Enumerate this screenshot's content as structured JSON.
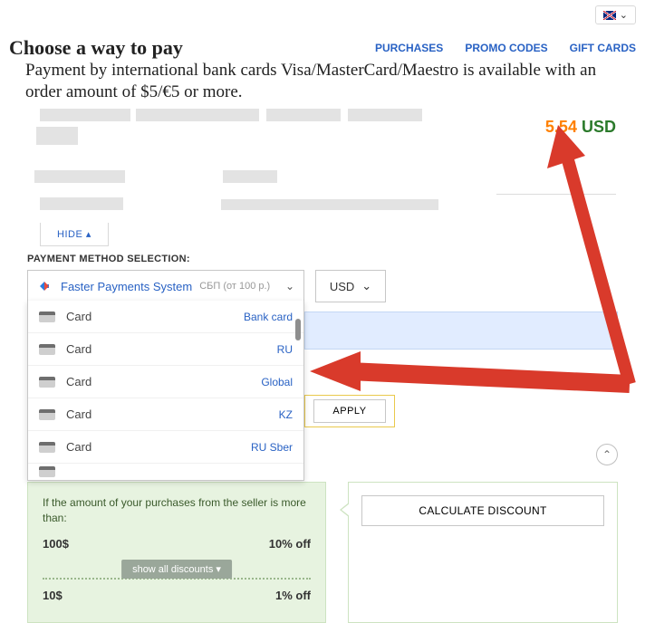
{
  "locale": {
    "chevron": "⌄"
  },
  "header": {
    "title": "Choose a way to pay",
    "nav": {
      "purchases": "PURCHASES",
      "promo": "PROMO CODES",
      "gift": "GIFT CARDS"
    }
  },
  "info_text": "Payment by international bank cards Visa/MasterCard/Maestro is available with an order amount of $5/€5 or more.",
  "price": {
    "amount": "5.54",
    "currency": "USD"
  },
  "hide_btn": "HIDE ▴",
  "pms_label": "PAYMENT METHOD SELECTION:",
  "payment_select": {
    "name": "Faster Payments System",
    "hint": "СБП (от 100 р.)",
    "chev": "⌄"
  },
  "currency": {
    "value": "USD",
    "chev": "⌄"
  },
  "dropdown": [
    {
      "label": "Card",
      "region": "Bank card"
    },
    {
      "label": "Card",
      "region": "RU"
    },
    {
      "label": "Card",
      "region": "Global"
    },
    {
      "label": "Card",
      "region": "KZ"
    },
    {
      "label": "Card",
      "region": "RU Sber"
    }
  ],
  "apply_btn": "APPLY",
  "scroll_up": "⌃",
  "discount": {
    "intro": "If the amount of your purchases from the seller is more than:",
    "row1": {
      "amt": "100$",
      "off": "10% off"
    },
    "show_all": "show all discounts ▾",
    "row2": {
      "amt": "10$",
      "off": "1% off"
    },
    "calc_btn": "CALCULATE DISCOUNT"
  }
}
